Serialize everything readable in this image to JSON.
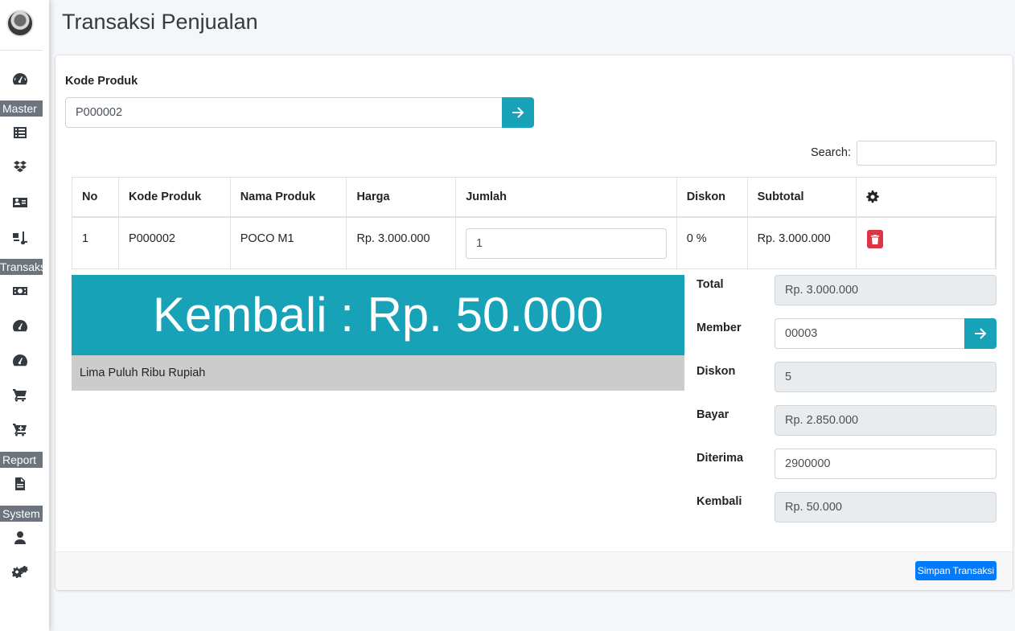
{
  "page": {
    "title": "Transaksi Penjualan"
  },
  "sidebar": {
    "headers": [
      "Master",
      "Transaksi",
      "Report",
      "System"
    ],
    "icons": [
      "dashboard-icon",
      "list-icon",
      "dropbox-icon",
      "id-card-icon",
      "dolly-icon",
      "money-icon",
      "dashboard-icon",
      "dashboard-icon",
      "cart-icon",
      "cart-plus-icon",
      "file-icon",
      "user-icon",
      "cogs-icon"
    ]
  },
  "form": {
    "kode_label": "Kode Produk",
    "kode_value": "P000002"
  },
  "search": {
    "label": "Search:",
    "value": ""
  },
  "table": {
    "columns": [
      "No",
      "Kode Produk",
      "Nama Produk",
      "Harga",
      "Jumlah",
      "Diskon",
      "Subtotal"
    ],
    "rows": [
      {
        "no": "1",
        "kode": "P000002",
        "nama": "POCO M1",
        "harga": "Rp. 3.000.000",
        "jumlah": "1",
        "diskon": "0 %",
        "subtotal": "Rp. 3.000.000"
      }
    ]
  },
  "kembali_display": "Kembali : Rp. 50.000",
  "terbilang": "Lima Puluh Ribu Rupiah",
  "summary": {
    "total_label": "Total",
    "total_value": "Rp. 3.000.000",
    "member_label": "Member",
    "member_value": "00003",
    "diskon_label": "Diskon",
    "diskon_value": "5",
    "bayar_label": "Bayar",
    "bayar_value": "Rp. 2.850.000",
    "diterima_label": "Diterima",
    "diterima_value": "2900000",
    "kembali_label": "Kembali",
    "kembali_value": "Rp. 50.000"
  },
  "footer": {
    "save_label": "Simpan Transaksi"
  },
  "colors": {
    "info": "#17a2b8",
    "primary": "#007bff",
    "danger": "#dc3545",
    "sidebar_header": "#6c757d"
  }
}
